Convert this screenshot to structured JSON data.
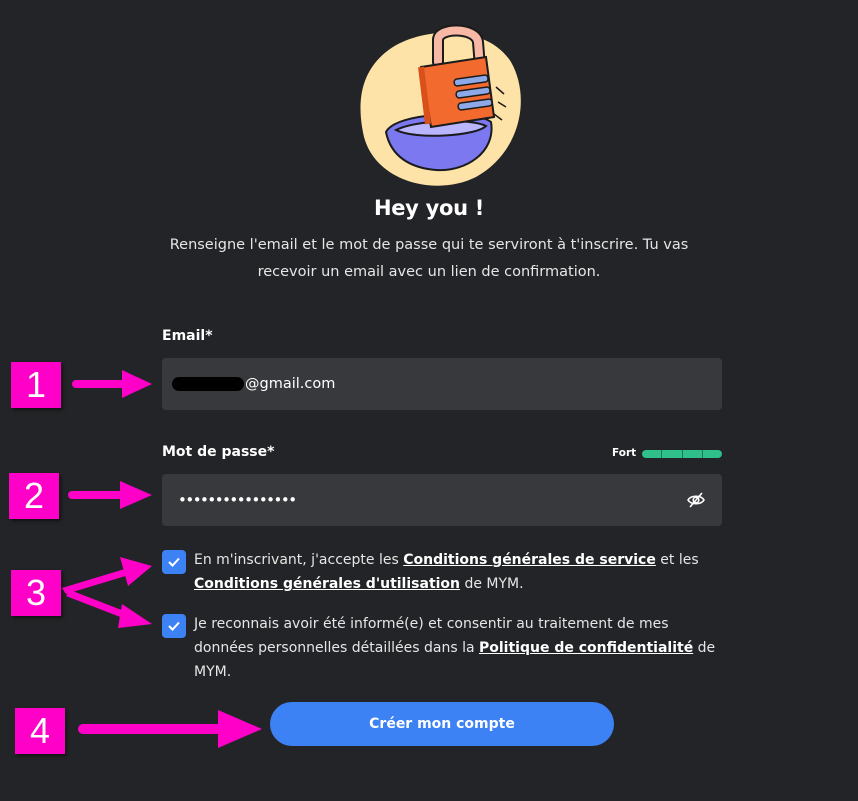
{
  "header": {
    "title": "Hey you !",
    "subtitle": "Renseigne l'email et le mot de passe qui te serviront à t'inscrire. Tu vas recevoir un email avec un lien de confirmation."
  },
  "email": {
    "label": "Email*",
    "value_visible_suffix": "@gmail.com"
  },
  "password": {
    "label": "Mot de passe*",
    "masked_value": "••••••••••••••••",
    "strength_label": "Fort",
    "strength_level": 1.0
  },
  "consents": [
    {
      "checked": true,
      "text_1": "En m'inscrivant, j'accepte les ",
      "link_1": "Conditions générales de service",
      "text_2": " et les ",
      "link_2": "Conditions générales d'utilisation",
      "text_3": " de MYM."
    },
    {
      "checked": true,
      "text_1": "Je reconnais avoir été informé(e) et consentir au traitement de mes données personnelles détaillées dans la ",
      "link_1": "Politique de confidentialité",
      "text_2": " de MYM."
    }
  ],
  "submit": {
    "label": "Créer mon compte"
  },
  "annotations": {
    "step_1": "1",
    "step_2": "2",
    "step_3": "3",
    "step_4": "4",
    "color": "#ff00c8"
  },
  "colors": {
    "background": "#232427",
    "field": "#38393d",
    "accent": "#3d82f5",
    "strength": "#2fbf8a"
  },
  "icons": [
    "padlock-illustration",
    "eye-off-icon",
    "check-icon",
    "arrow-icon"
  ]
}
